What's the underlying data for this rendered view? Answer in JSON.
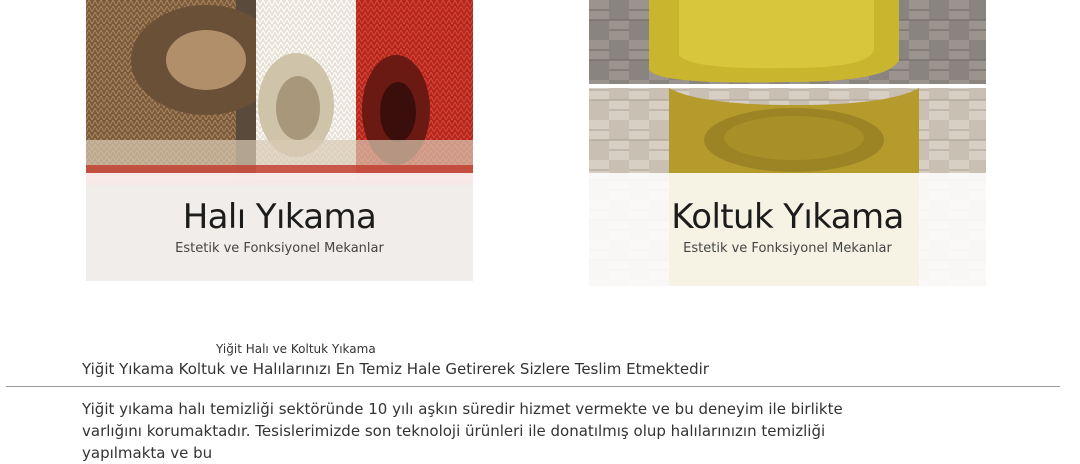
{
  "cards": [
    {
      "title": "Halı Yıkama",
      "subtitle": "Estetik ve Fonksiyonel Mekanlar",
      "image_icon": "carpet-rolls-image"
    },
    {
      "title": "Koltuk Yıkama",
      "subtitle": "Estetik ve Fonksiyonel Mekanlar",
      "image_icon": "armchair-before-after-image"
    }
  ],
  "intro": {
    "small_title": "Yiğit Halı ve Koltuk Yıkama",
    "heading": "Yiğit Yıkama Koltuk ve Halılarınızı En Temiz Hale Getirerek Sizlere Teslim Etmektedir",
    "body": "Yiğit yıkama halı temizliği sektöründe 10 yılı aşkın süredir hizmet vermekte ve bu deneyim ile birlikte varlığını korumaktadır. Tesislerimizde son teknoloji ürünleri ile donatılmış olup halılarınızın temizliği yapılmakta ve bu"
  },
  "colors": {
    "text": "#333333",
    "title": "#1c1c1c",
    "divider": "#9a9a9a"
  }
}
